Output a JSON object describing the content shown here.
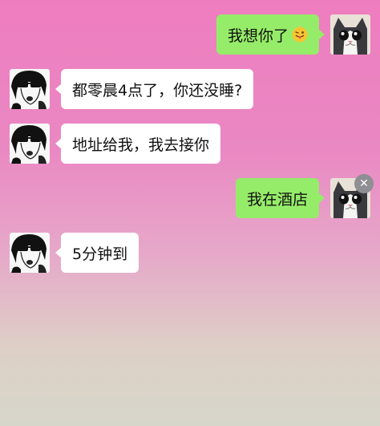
{
  "messages": [
    {
      "side": "out",
      "text": "我想你了",
      "emoji": "tongue-wink-emoji"
    },
    {
      "side": "in",
      "text": "都零晨4点了，你还没睡?"
    },
    {
      "side": "in",
      "text": "地址给我，我去接你"
    },
    {
      "side": "out",
      "text": "我在酒店"
    },
    {
      "side": "in",
      "text": "5分钟到"
    }
  ],
  "avatars": {
    "self": "cat-avatar",
    "contact": "sunglasses-person-avatar"
  },
  "colors": {
    "outgoing_bubble": "#95ec69",
    "incoming_bubble": "#ffffff",
    "background_top": "#ee7dbf",
    "background_bottom": "#d7d6cb"
  },
  "icons": {
    "close": "close-icon",
    "close_glyph": "✕"
  }
}
